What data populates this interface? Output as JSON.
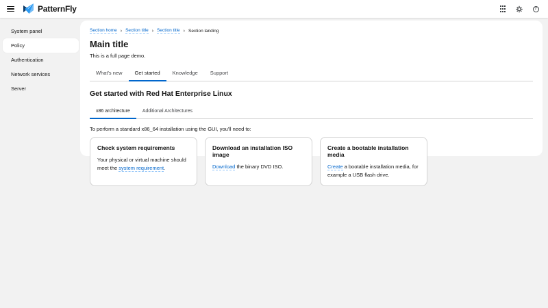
{
  "masthead": {
    "brand": "PatternFly"
  },
  "sidebar": {
    "items": [
      {
        "label": "System panel",
        "selected": false
      },
      {
        "label": "Policy",
        "selected": true
      },
      {
        "label": "Authentication",
        "selected": false
      },
      {
        "label": "Network services",
        "selected": false
      },
      {
        "label": "Server",
        "selected": false
      }
    ]
  },
  "breadcrumb": {
    "separator": "›",
    "items": [
      {
        "label": "Section home",
        "link": true
      },
      {
        "label": "Section title",
        "link": true
      },
      {
        "label": "Section title",
        "link": true
      },
      {
        "label": "Section landing",
        "link": false
      }
    ]
  },
  "page": {
    "title": "Main title",
    "subtitle": "This is a full page demo."
  },
  "tabs": {
    "primary": [
      {
        "label": "What's new",
        "active": false
      },
      {
        "label": "Get started",
        "active": true
      },
      {
        "label": "Knowledge",
        "active": false
      },
      {
        "label": "Support",
        "active": false
      }
    ],
    "section_heading": "Get started with Red Hat Enterprise Linux",
    "secondary": [
      {
        "label": "x86 architecture",
        "active": true
      },
      {
        "label": "Additional Architectures",
        "active": false
      }
    ],
    "intro": "To perform a standard x86_64 installation using the GUI, you'll need to:"
  },
  "cards": [
    {
      "title": "Check system requirements",
      "body_pre": "Your physical or virtual machine should meet the ",
      "link": "system requirement",
      "body_post": "."
    },
    {
      "title": "Download an installation ISO image",
      "body_pre": "",
      "link": "Download",
      "body_post": " the binary DVD ISO."
    },
    {
      "title": "Create a bootable installation media",
      "body_pre": "",
      "link": "Create",
      "body_post": " a bootable installation media, for example a USB flash drive."
    }
  ],
  "colors": {
    "accent": "#0066cc",
    "background": "#f2f2f2",
    "surface": "#ffffff",
    "text": "#151515",
    "border": "#d2d2d2",
    "logo_navy": "#0f3b66",
    "logo_blue": "#2b9af3",
    "logo_light_blue": "#73bcf7"
  }
}
